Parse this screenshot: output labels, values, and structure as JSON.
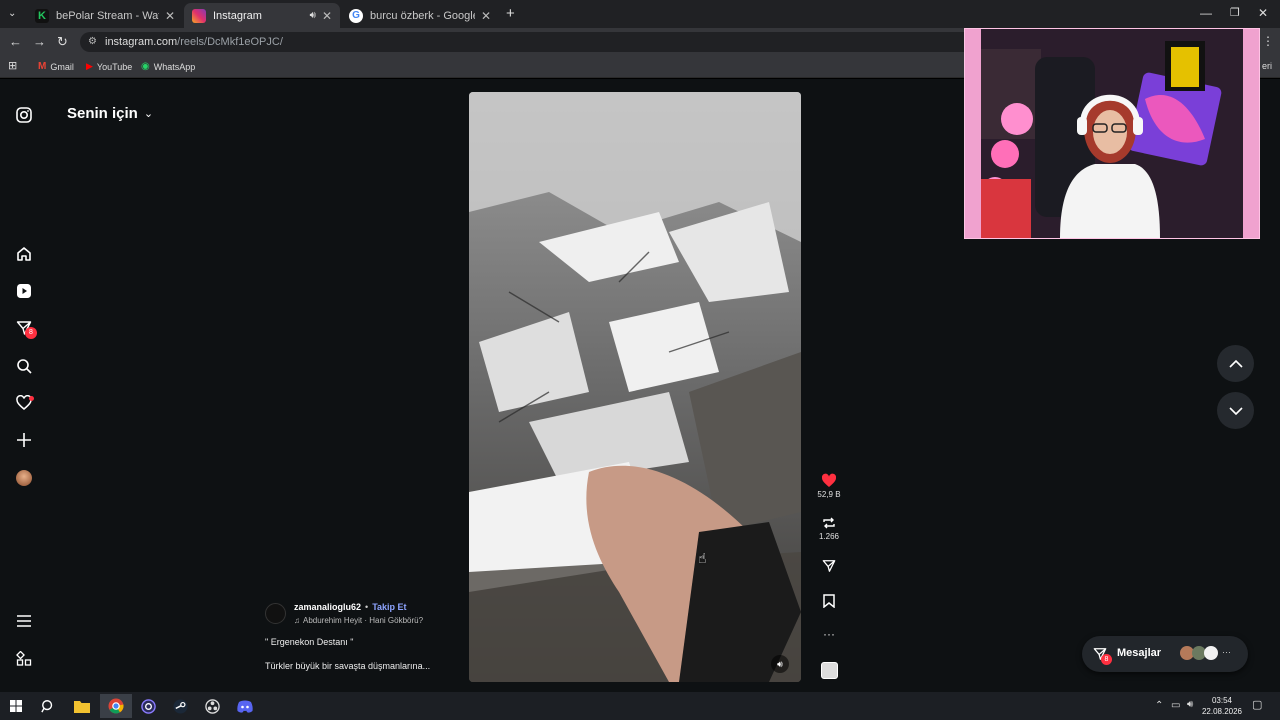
{
  "browser": {
    "tabs": [
      {
        "title": "bePolar Stream - Watch Live on",
        "fav_color": "#22c55e"
      },
      {
        "title": "Instagram",
        "fav_color": "#e1306c"
      },
      {
        "title": "burcu özberk - Google'da Ara",
        "fav_color": "#4285f4"
      }
    ],
    "url_host": "instagram.com",
    "url_path": "/reels/DcMkf1eOPJC/",
    "bookmarks": [
      "Gmail",
      "YouTube",
      "WhatsApp"
    ],
    "bookmarks_overflow": "eri"
  },
  "instagram": {
    "feed_title": "Senin için",
    "nav_badge_messages": "8",
    "post": {
      "username": "zamanalioglu62",
      "separator": "•",
      "follow_label": "Takip Et",
      "music": "Abdurehim Heyit · Hani Gökbörü?",
      "caption_line1": "\" Ergenekon Destanı \"",
      "caption_line2": "Türkler büyük bir savaşta düşmanlarına..."
    },
    "actions": {
      "likes": "52,9 B",
      "reposts": "1.266"
    },
    "messages": {
      "label": "Mesajlar",
      "badge": "8"
    }
  },
  "taskbar": {
    "time": "03:54",
    "date": "22.08.2026"
  },
  "colors": {
    "like_red": "#ff3040",
    "follow_blue": "#8da4ff",
    "badge_red": "#ff3040"
  }
}
